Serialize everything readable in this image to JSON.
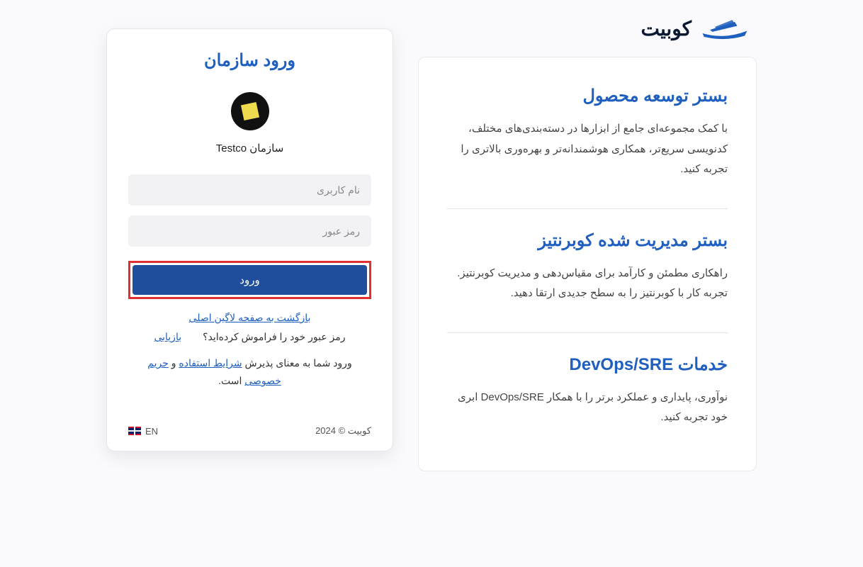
{
  "brand": {
    "name": "کوبیت"
  },
  "info": {
    "sections": [
      {
        "title": "بستر توسعه محصول",
        "desc": "با کمک مجموعه‌ای جامع از ابزارها در دسته‌بندی‌های مختلف، کدنویسی سریع‌تر، همکاری هوشمندانه‌تر و بهره‌وری بالاتری را تجربه کنید."
      },
      {
        "title": "بستر مدیریت شده کوبرنتیز",
        "desc": "راهکاری مطمئن و کارآمد برای مقیاس‌دهی و مدیریت کوبرنتیز. تجربه کار با کوبرنتیز را به سطح جدیدی ارتقا دهید."
      },
      {
        "title": "خدمات DevOps/SRE",
        "desc": "نوآوری، پایداری و عملکرد برتر را با همکار DevOps/SRE ابری خود تجربه کنید."
      }
    ]
  },
  "login": {
    "title": "ورود سازمان",
    "org_label": "سازمان Testco",
    "username_placeholder": "نام کاربری",
    "password_placeholder": "رمز عبور",
    "submit": "ورود",
    "back_link": "بازگشت به صفحه لاگین اصلی",
    "forgot_text": "رمز عبور خود را فراموش کرده‌اید؟",
    "recover": "بازیابی",
    "terms_prefix": "ورود شما به معنای پذیرش ",
    "terms_link": "شرایط استفاده",
    "terms_and": " و ",
    "privacy_link": "حریم خصوصی",
    "terms_suffix": " است."
  },
  "footer": {
    "copyright": "کوبیت © 2024",
    "lang": "EN"
  }
}
